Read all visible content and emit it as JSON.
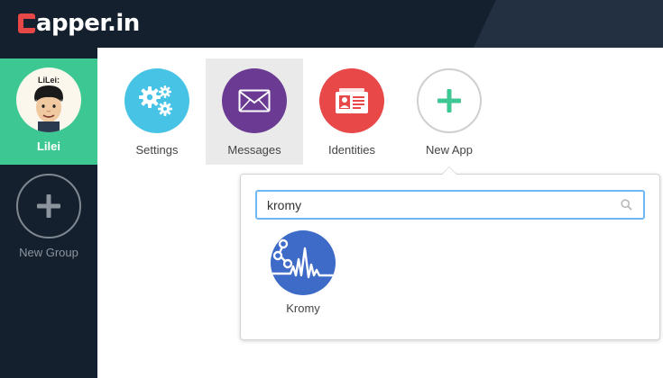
{
  "brand": {
    "logo_text": "apper.in"
  },
  "sidebar": {
    "group": {
      "label": "Lilei",
      "avatar_tag": "LiLei:"
    },
    "new_group": {
      "label": "New Group"
    }
  },
  "apps": [
    {
      "label": "Settings",
      "icon": "gears-icon",
      "color": "#47c4e5"
    },
    {
      "label": "Messages",
      "icon": "envelope-icon",
      "color": "#6b3a92",
      "selected": true
    },
    {
      "label": "Identities",
      "icon": "id-card-icon",
      "color": "#e84848"
    },
    {
      "label": "New App",
      "icon": "plus-icon",
      "color": "#3cc793"
    }
  ],
  "search": {
    "value": "kromy",
    "placeholder": ""
  },
  "results": [
    {
      "label": "Kromy",
      "icon": "kromy-icon",
      "color": "#3e6bc7"
    }
  ],
  "colors": {
    "brand_red": "#e74847",
    "sidebar_bg": "#15202e",
    "selected_group": "#3cc793",
    "search_focus": "#6fb6f2"
  }
}
